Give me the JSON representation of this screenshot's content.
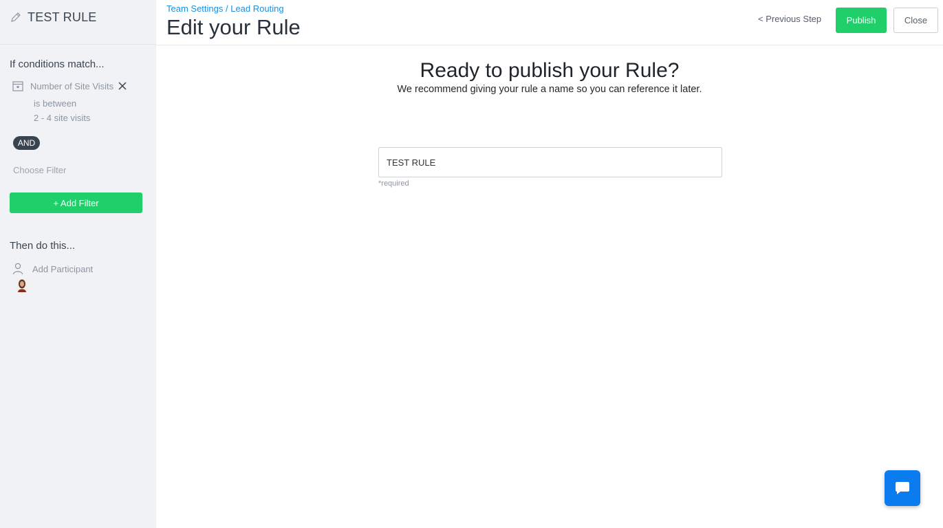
{
  "sidebar": {
    "rule_name": "TEST RULE",
    "conditions_title": "If conditions match...",
    "condition": {
      "field": "Number of Site Visits",
      "operator": "is between",
      "value": "2 - 4 site visits"
    },
    "and_label": "AND",
    "choose_filter": "Choose Filter",
    "add_filter_label": "+ Add Filter",
    "actions_title": "Then do this...",
    "add_participant": "Add Participant"
  },
  "header": {
    "breadcrumb": [
      "Team Settings",
      "Lead Routing"
    ],
    "breadcrumb_separator": " / ",
    "title": "Edit your Rule",
    "previous_step": "< Previous Step",
    "publish": "Publish",
    "close": "Close"
  },
  "main": {
    "heading": "Ready to publish your Rule?",
    "subheading": "We recommend giving your rule a name so you can reference it later.",
    "rule_name_value": "TEST RULE",
    "required_note": "*required"
  },
  "icons": {
    "edit": "pencil-icon",
    "condition": "calendar-icon",
    "remove": "close-icon",
    "participant": "person-icon",
    "chat": "chat-bubble-icon"
  },
  "colors": {
    "accent_green": "#1fcf6a",
    "link_blue": "#1a8fe0",
    "chat_blue": "#0a7cf0",
    "sidebar_bg": "#f0f2f5",
    "badge_dark": "#3a4450"
  }
}
